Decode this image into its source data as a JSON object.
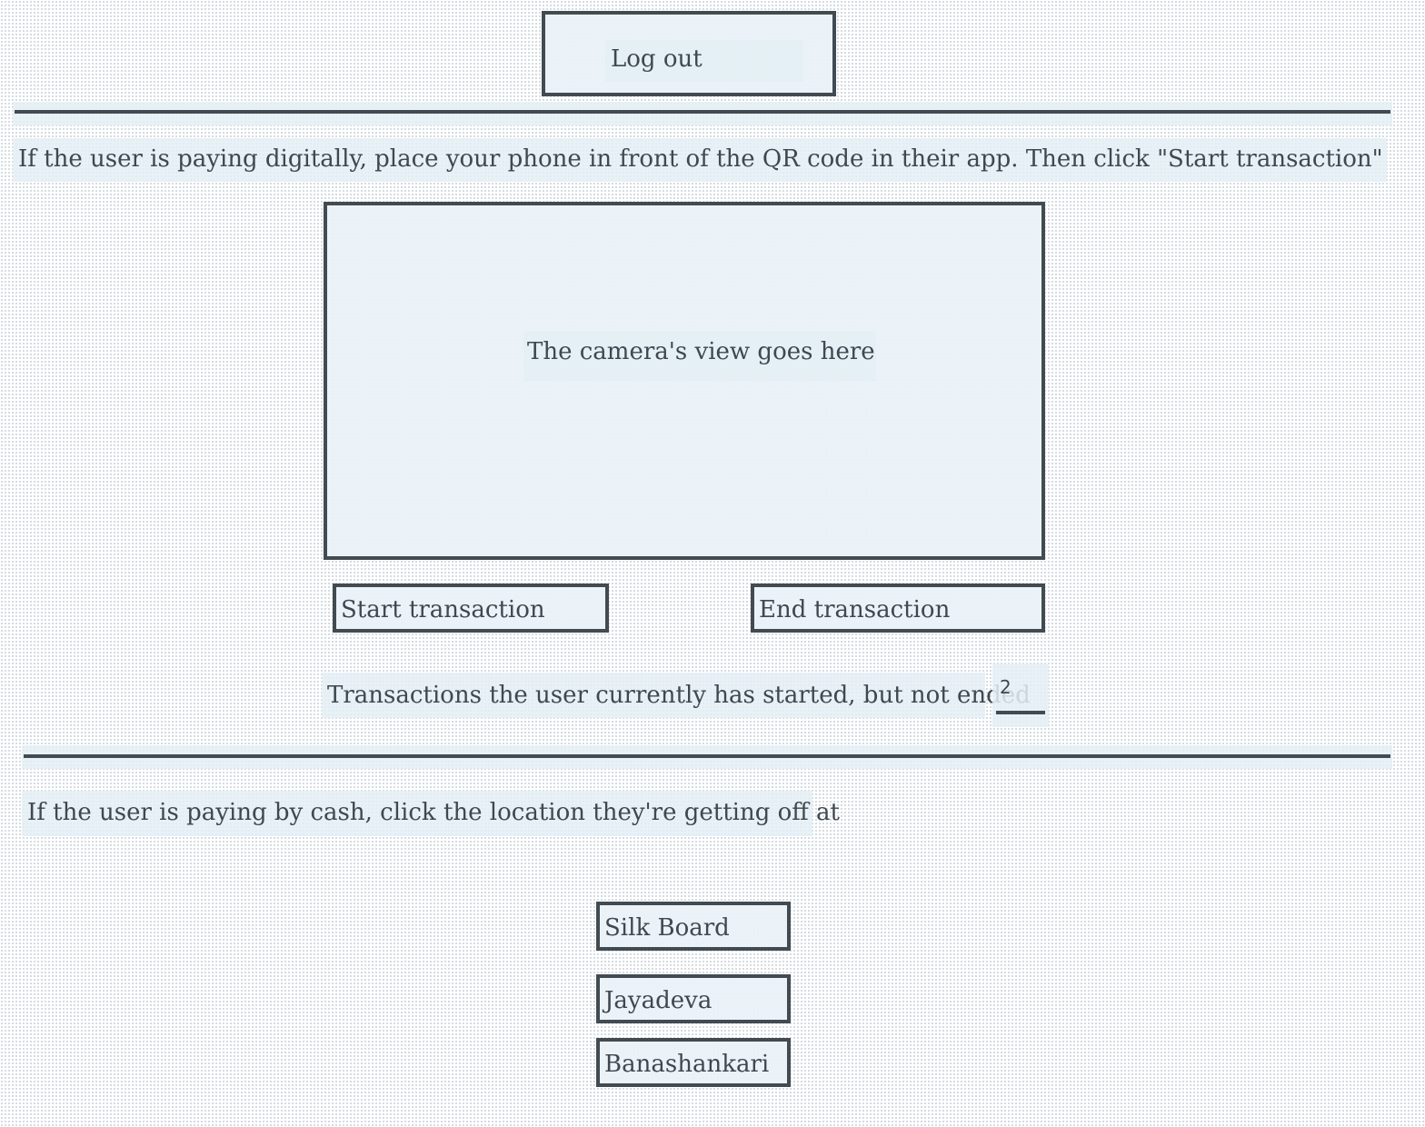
{
  "header": {
    "logout_label": "Log out"
  },
  "digital": {
    "instruction": "If the user is paying digitally, place your phone in front of the QR code in their app. Then click \"Start transaction\"",
    "camera_placeholder": "The camera's view goes here",
    "start_label": "Start transaction",
    "end_label": "End transaction",
    "open_count_label": "Transactions the user currently has started, but not ended",
    "open_count_value": "2"
  },
  "cash": {
    "instruction": "If the user is paying by cash, click the location they're getting off at",
    "locations": [
      {
        "label": "Silk Board"
      },
      {
        "label": "Jayadeva"
      },
      {
        "label": "Banashankari"
      }
    ]
  },
  "colors": {
    "border": "#434b52",
    "text": "#3f4850",
    "panel_fill": "#eaf2f7"
  }
}
